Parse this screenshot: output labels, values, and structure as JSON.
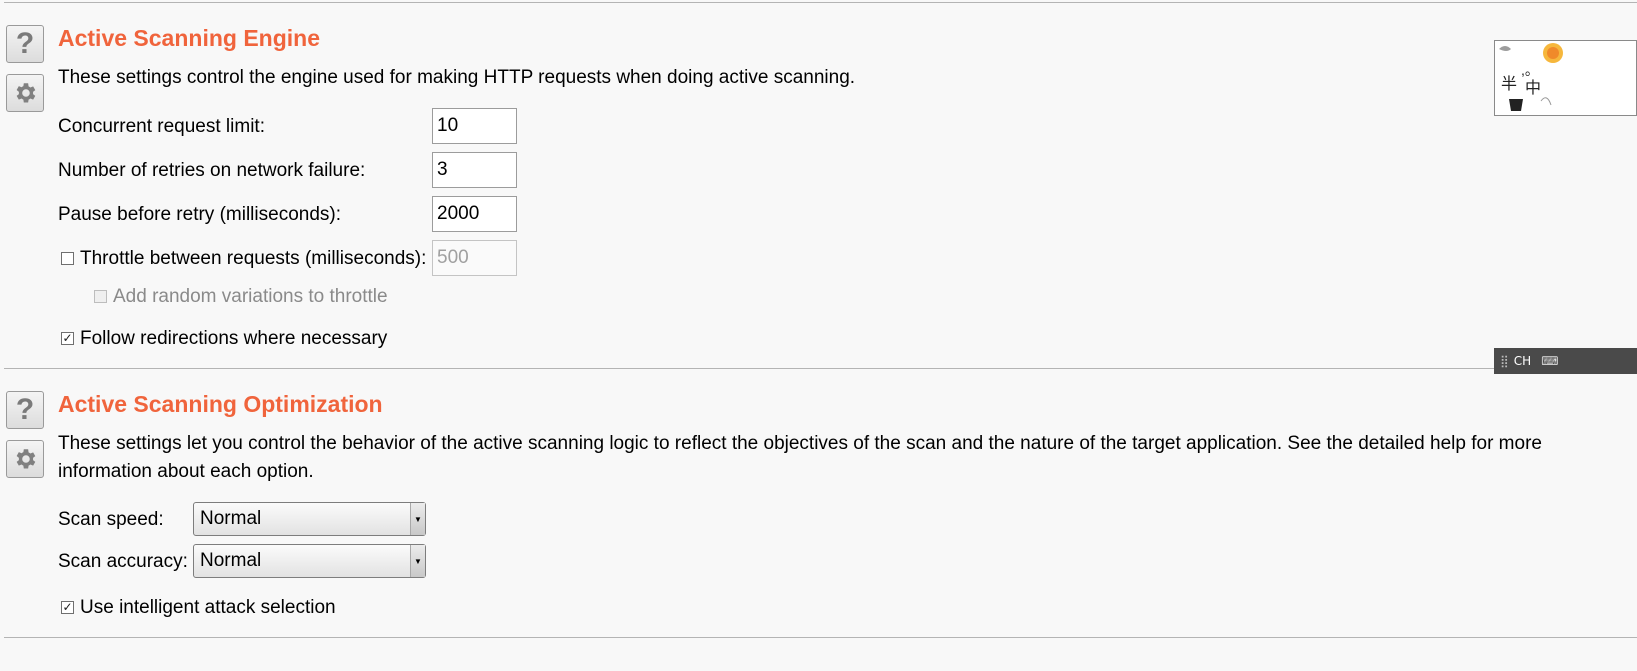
{
  "engine": {
    "title": "Active Scanning Engine",
    "description": "These settings control the engine used for making HTTP requests when doing active scanning.",
    "concurrent": {
      "label": "Concurrent request limit:",
      "value": "10"
    },
    "retries": {
      "label": "Number of retries on network failure:",
      "value": "3"
    },
    "pause": {
      "label": "Pause before retry (milliseconds):",
      "value": "2000"
    },
    "throttle": {
      "label": "Throttle between requests (milliseconds):",
      "value": "500",
      "checked": false
    },
    "random": {
      "label": "Add random variations to throttle",
      "checked": false
    },
    "follow": {
      "label": "Follow redirections where necessary",
      "checked": true
    }
  },
  "optimization": {
    "title": "Active Scanning Optimization",
    "description": "These settings let you control the behavior of the active scanning logic to reflect the objectives of the scan and the nature of the target application. See the detailed help for more information about each option.",
    "speed": {
      "label": "Scan speed:",
      "value": "Normal"
    },
    "accuracy": {
      "label": "Scan accuracy:",
      "value": "Normal"
    },
    "intelligent": {
      "label": "Use intelligent attack selection",
      "checked": true
    }
  },
  "ime": {
    "label": "CH"
  },
  "colors": {
    "accent": "#f0643c"
  }
}
